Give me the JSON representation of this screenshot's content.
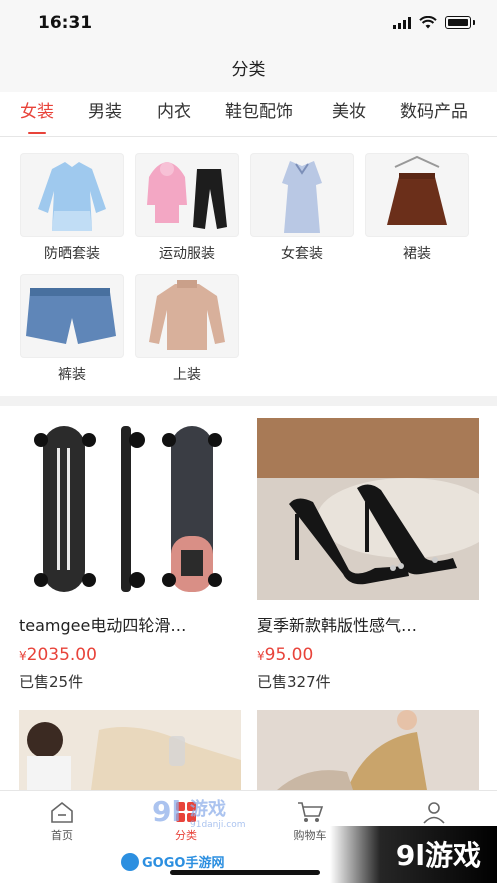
{
  "status_bar": {
    "time": "16:31"
  },
  "nav": {
    "title": "分类"
  },
  "tabs": [
    {
      "label": "女装",
      "active": true
    },
    {
      "label": "男装",
      "active": false
    },
    {
      "label": "内衣",
      "active": false
    },
    {
      "label": "鞋包配饰",
      "active": false
    },
    {
      "label": "美妆",
      "active": false
    },
    {
      "label": "数码产品",
      "active": false
    }
  ],
  "subcategories": [
    {
      "label": "防晒套装"
    },
    {
      "label": "运动服装"
    },
    {
      "label": "女套装"
    },
    {
      "label": "裙装"
    },
    {
      "label": "裤装"
    },
    {
      "label": "上装"
    }
  ],
  "products": [
    {
      "name": "teamgee电动四轮滑…",
      "currency": "¥",
      "price": "2035.00",
      "sold": "已售25件"
    },
    {
      "name": "夏季新款韩版性感气…",
      "currency": "¥",
      "price": "95.00",
      "sold": "已售327件"
    }
  ],
  "tab_bar": {
    "items": [
      {
        "label": "首页",
        "icon": "home-icon",
        "active": false
      },
      {
        "label": "分类",
        "icon": "category-icon",
        "active": true
      },
      {
        "label": "购物车",
        "icon": "cart-icon",
        "active": false
      },
      {
        "label": "",
        "icon": "user-icon",
        "active": false
      }
    ]
  },
  "watermarks": {
    "top": "游戏",
    "sub": "91danji.com",
    "bottom_left": "GOGO手游网",
    "bottom_right": "9l游戏"
  },
  "colors": {
    "accent": "#e8433a",
    "bar_bg": "#f7f7f7",
    "divider": "#f2f2f2"
  }
}
